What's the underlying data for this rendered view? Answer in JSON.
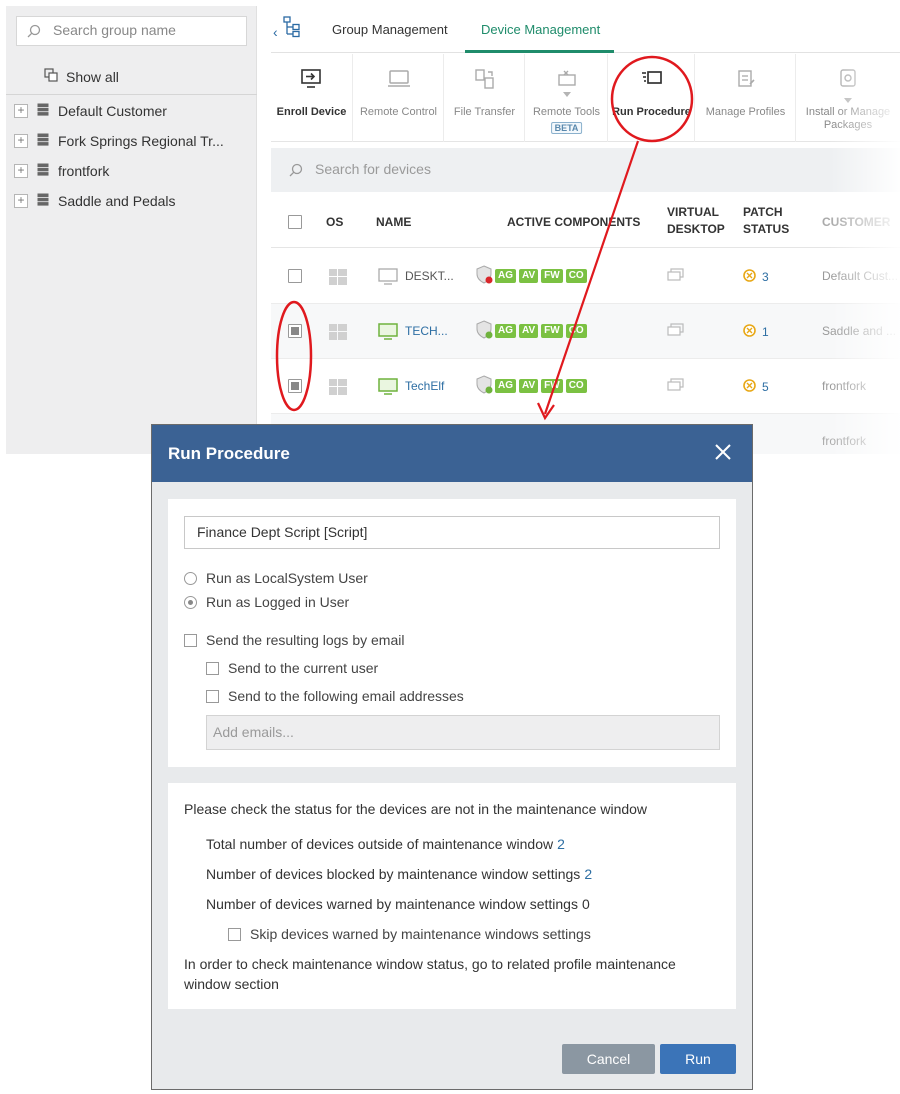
{
  "sidebar": {
    "search_placeholder": "Search group name",
    "show_all": "Show all",
    "groups": [
      "Default Customer",
      "Fork Springs Regional Tr...",
      "frontfork",
      "Saddle and Pedals"
    ]
  },
  "tabs": [
    "Group Management",
    "Device Management"
  ],
  "active_tab": "Device Management",
  "toolbar": [
    {
      "label": "Enroll Device",
      "icon": "enroll-device-icon",
      "enabled": true
    },
    {
      "label": "Remote Control",
      "icon": "remote-control-icon",
      "enabled": false
    },
    {
      "label": "File Transfer",
      "icon": "file-transfer-icon",
      "enabled": false
    },
    {
      "label": "Remote Tools",
      "icon": "remote-tools-icon",
      "enabled": false,
      "badge": "BETA"
    },
    {
      "label": "Run Procedure",
      "icon": "run-procedure-icon",
      "enabled": true
    },
    {
      "label": "Manage Profiles",
      "icon": "manage-profiles-icon",
      "enabled": false
    },
    {
      "label": "Install or Manage Packages",
      "icon": "install-packages-icon",
      "enabled": false
    }
  ],
  "device_search_placeholder": "Search for devices",
  "table": {
    "headers": {
      "os": "OS",
      "name": "NAME",
      "active_components": "ACTIVE COMPONENTS",
      "virtual_desktop": "VIRTUAL DESKTOP",
      "patch_status": "PATCH STATUS",
      "customer": "CUSTOMER"
    },
    "rows": [
      {
        "checked": false,
        "name": "DESKT...",
        "components": [
          "AG",
          "AV",
          "FW",
          "CO"
        ],
        "patch": "3",
        "customer": "Default Cust..."
      },
      {
        "checked": true,
        "name": "TECH...",
        "components": [
          "AG",
          "AV",
          "FW",
          "CO"
        ],
        "patch": "1",
        "customer": "Saddle and ..."
      },
      {
        "checked": true,
        "name": "TechElf",
        "components": [
          "AG",
          "AV",
          "FW",
          "CO"
        ],
        "patch": "5",
        "customer": "frontfork"
      }
    ],
    "partial_row_customer": "frontfork"
  },
  "modal": {
    "title": "Run Procedure",
    "procedure_value": "Finance Dept Script [Script]",
    "run_as_options": [
      "Run as LocalSystem User",
      "Run as Logged in User"
    ],
    "run_as_selected": "Run as Logged in User",
    "send_logs_label": "Send the resulting logs by email",
    "send_current_user_label": "Send to the current user",
    "send_following_label": "Send to the following email addresses",
    "emails_placeholder": "Add emails...",
    "status_heading": "Please check the status for the devices are not in the maintenance window",
    "outside_label": "Total number of devices outside of maintenance window",
    "outside_value": "2",
    "blocked_label": "Number of devices blocked by maintenance window settings",
    "blocked_value": "2",
    "warned_label": "Number of devices warned by maintenance window settings",
    "warned_value": "0",
    "skip_label": "Skip devices warned by maintenance windows settings",
    "footer_note": "In order to check maintenance window status, go to related profile maintenance window section",
    "cancel_label": "Cancel",
    "run_label": "Run"
  },
  "colors": {
    "accent_green": "#1f8c6b",
    "modal_header": "#3b6294",
    "run_button": "#3b74b8",
    "component_badge": "#7bc142",
    "annotation": "#e0191e"
  }
}
